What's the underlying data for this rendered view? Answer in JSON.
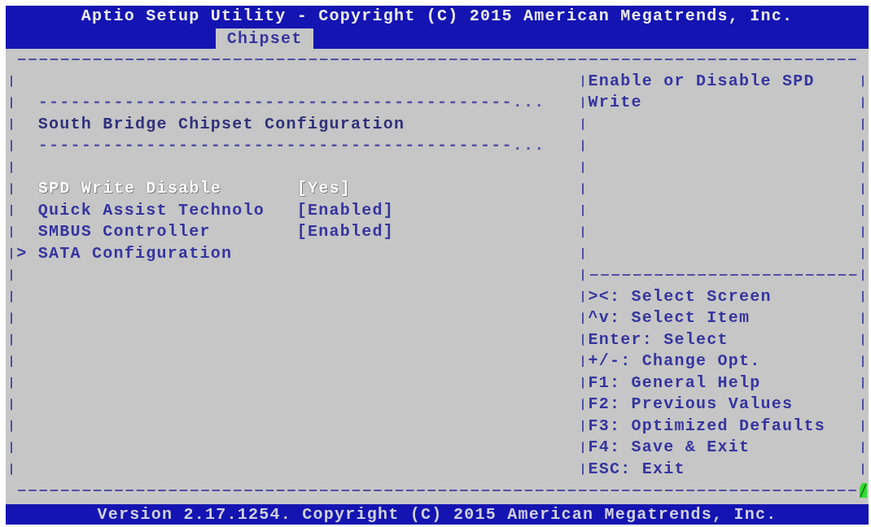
{
  "header": {
    "title": "Aptio Setup Utility - Copyright (C) 2015 American Megatrends, Inc.",
    "tabs": [
      {
        "label": "Chipset",
        "selected": true
      }
    ]
  },
  "settings": {
    "items": [
      {
        "kind": "blank"
      },
      {
        "kind": "separator",
        "text": "--------------------------------------------..."
      },
      {
        "kind": "heading",
        "text": "South Bridge Chipset Configuration"
      },
      {
        "kind": "separator",
        "text": "--------------------------------------------..."
      },
      {
        "kind": "blank"
      },
      {
        "kind": "option",
        "label": "SPD Write Disable",
        "value": "[Yes]",
        "selected": true
      },
      {
        "kind": "option",
        "label": "Quick Assist Technolo",
        "value": "[Enabled]",
        "selected": false
      },
      {
        "kind": "option",
        "label": "SMBUS Controller",
        "value": "[Enabled]",
        "selected": false
      },
      {
        "kind": "submenu",
        "marker": ">",
        "label": "SATA Configuration",
        "selected": false
      }
    ]
  },
  "help": {
    "description": "Enable or Disable SPD Write",
    "keys": [
      "><: Select Screen",
      "^v: Select Item",
      "Enter: Select",
      "+/-: Change Opt.",
      "F1: General Help",
      "F2: Previous Values",
      "F3: Optimized Defaults",
      "F4: Save & Exit",
      "ESC: Exit"
    ]
  },
  "footer": {
    "text": "Version 2.17.1254. Copyright (C) 2015 American Megatrends, Inc."
  }
}
